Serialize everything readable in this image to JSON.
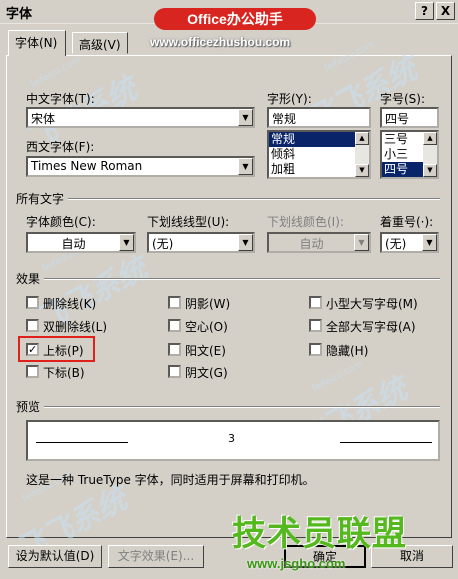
{
  "window": {
    "title": "字体",
    "help_label": "?",
    "close_label": "X"
  },
  "banner": {
    "text": "Office办公助手",
    "url": "www.officezhushou.com"
  },
  "tabs": [
    {
      "label": "字体(N)"
    },
    {
      "label": "高级(V)"
    }
  ],
  "font": {
    "cjk_label": "中文字体(T):",
    "cjk_value": "宋体",
    "western_label": "西文字体(F):",
    "western_value": "Times New Roman",
    "style_label": "字形(Y):",
    "style_value": "常规",
    "style_options": [
      "常规",
      "倾斜",
      "加粗"
    ],
    "size_label": "字号(S):",
    "size_value": "四号",
    "size_options": [
      "三号",
      "小三",
      "四号"
    ]
  },
  "all_text": {
    "section_label": "所有文字",
    "color_label": "字体颜色(C):",
    "color_value": "自动",
    "underline_label": "下划线线型(U):",
    "underline_value": "(无)",
    "underline_color_label": "下划线颜色(I):",
    "underline_color_value": "自动",
    "emphasis_label": "着重号(·):",
    "emphasis_value": "(无)"
  },
  "effects": {
    "section_label": "效果",
    "items": [
      {
        "label": "删除线(K)",
        "checked": false
      },
      {
        "label": "双删除线(L)",
        "checked": false
      },
      {
        "label": "上标(P)",
        "checked": true
      },
      {
        "label": "下标(B)",
        "checked": false
      },
      {
        "label": "阴影(W)",
        "checked": false
      },
      {
        "label": "空心(O)",
        "checked": false
      },
      {
        "label": "阳文(E)",
        "checked": false
      },
      {
        "label": "阴文(G)",
        "checked": false
      },
      {
        "label": "小型大写字母(M)",
        "checked": false
      },
      {
        "label": "全部大写字母(A)",
        "checked": false
      },
      {
        "label": "隐藏(H)",
        "checked": false
      }
    ]
  },
  "preview": {
    "section_label": "预览",
    "sample_text": "3",
    "note": "这是一种 TrueType 字体，同时适用于屏幕和打印机。"
  },
  "footer": {
    "default_button": "设为默认值(D)",
    "text_effects_button": "文字效果(E)...",
    "ok_button": "确定",
    "cancel_button": "取消"
  },
  "watermark": {
    "logo_text": "技术员联盟",
    "logo_url": "www.jsgho.com",
    "repeat_text": "飞飞系统",
    "repeat_url": "feifeizu.com"
  },
  "colors": {
    "highlight": "#0a246a",
    "annotation_red": "#e0201a",
    "logo_green": "#55b81f"
  }
}
